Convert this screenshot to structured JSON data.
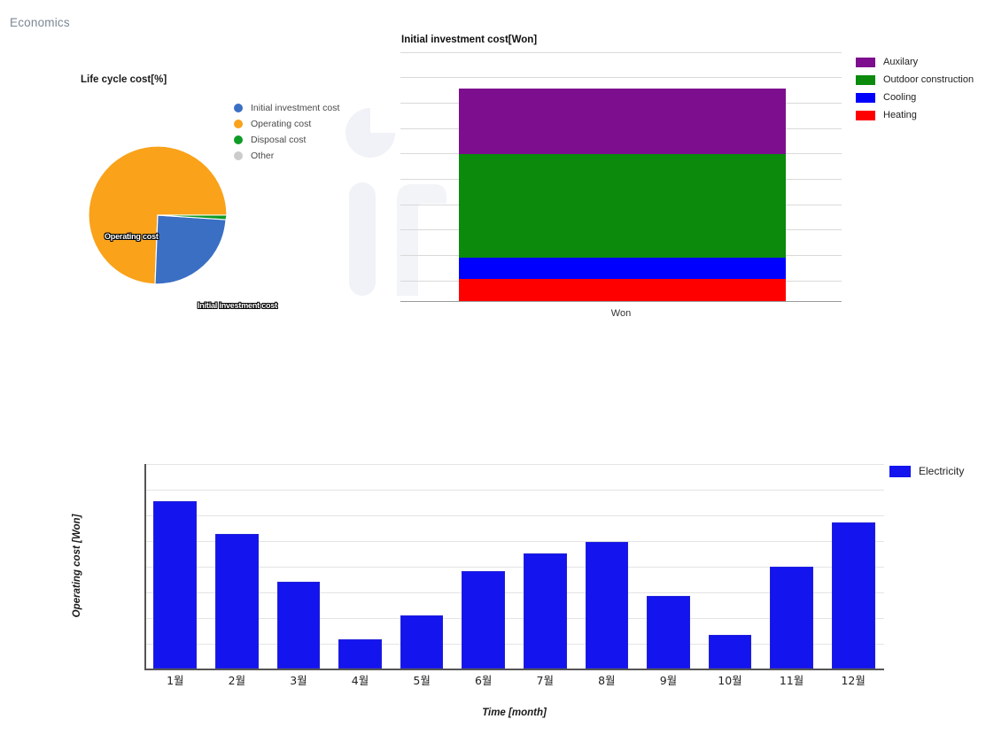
{
  "page": {
    "title": "Economics"
  },
  "pie": {
    "title": "Life cycle cost[%]",
    "legend": [
      {
        "label": "Initial investment cost",
        "color": "#3a6fc4"
      },
      {
        "label": "Operating cost",
        "color": "#f9a21a"
      },
      {
        "label": "Disposal cost",
        "color": "#0f9b27"
      },
      {
        "label": "Other",
        "color": "#cccccc"
      }
    ],
    "slice_labels": {
      "operating": "Operating cost",
      "initial": "Initial investment cost"
    },
    "chart_data": {
      "type": "pie",
      "title": "Life cycle cost[%]",
      "labels": [
        "Initial investment cost",
        "Operating cost",
        "Disposal cost",
        "Other"
      ],
      "values": [
        14.5,
        84.0,
        1.5,
        0.0
      ],
      "unit": "%",
      "colors": [
        "#3a6fc4",
        "#f9a21a",
        "#0f9b27",
        "#cccccc"
      ],
      "legend_position": "right",
      "start_angle_deg": 0,
      "direction": "clockwise"
    }
  },
  "stacked": {
    "title": "Initial investment cost[Won]",
    "xlabel": "Won",
    "legend": [
      {
        "label": "Auxilary",
        "color": "#7d0f8e"
      },
      {
        "label": "Outdoor construction",
        "color": "#0b8a0b"
      },
      {
        "label": "Cooling",
        "color": "#0000ff"
      },
      {
        "label": "Heating",
        "color": "#ff0000"
      }
    ],
    "chart_data": {
      "type": "bar",
      "stacked": true,
      "orientation": "vertical",
      "title": "Initial investment cost[Won]",
      "xlabel": "Won",
      "ylabel": "",
      "categories": [
        "Won"
      ],
      "series": [
        {
          "name": "Heating",
          "values": [
            1.0
          ],
          "color": "#ff0000"
        },
        {
          "name": "Cooling",
          "values": [
            1.0
          ],
          "color": "#0000ff"
        },
        {
          "name": "Outdoor construction",
          "values": [
            4.7
          ],
          "color": "#0b8a0b"
        },
        {
          "name": "Auxilary",
          "values": [
            3.0
          ],
          "color": "#7d0f8e"
        }
      ],
      "stack_total": 9.7,
      "ylim": [
        0,
        12
      ],
      "gridlines": 10,
      "grid": true,
      "legend_position": "top-right",
      "tick_labels_visible": false
    }
  },
  "monthly": {
    "xlabel": "Time [month]",
    "ylabel": "Operating cost [Won]",
    "legend": [
      {
        "label": "Electricity",
        "color": "#1414ef"
      }
    ],
    "chart_data": {
      "type": "bar",
      "title": "",
      "xlabel": "Time [month]",
      "ylabel": "Operating cost [Won]",
      "categories": [
        "1월",
        "2월",
        "3월",
        "4월",
        "5월",
        "6월",
        "7월",
        "8월",
        "9월",
        "10월",
        "11월",
        "12월"
      ],
      "series": [
        {
          "name": "Electricity",
          "color": "#1414ef",
          "values": [
            6.3,
            5.07,
            3.27,
            1.1,
            2.0,
            3.67,
            4.33,
            4.77,
            2.73,
            1.27,
            3.83,
            5.5
          ]
        }
      ],
      "ylim": [
        0,
        7.7
      ],
      "gridlines": 8,
      "grid": true,
      "tick_labels_visible": false,
      "legend_position": "right"
    }
  }
}
